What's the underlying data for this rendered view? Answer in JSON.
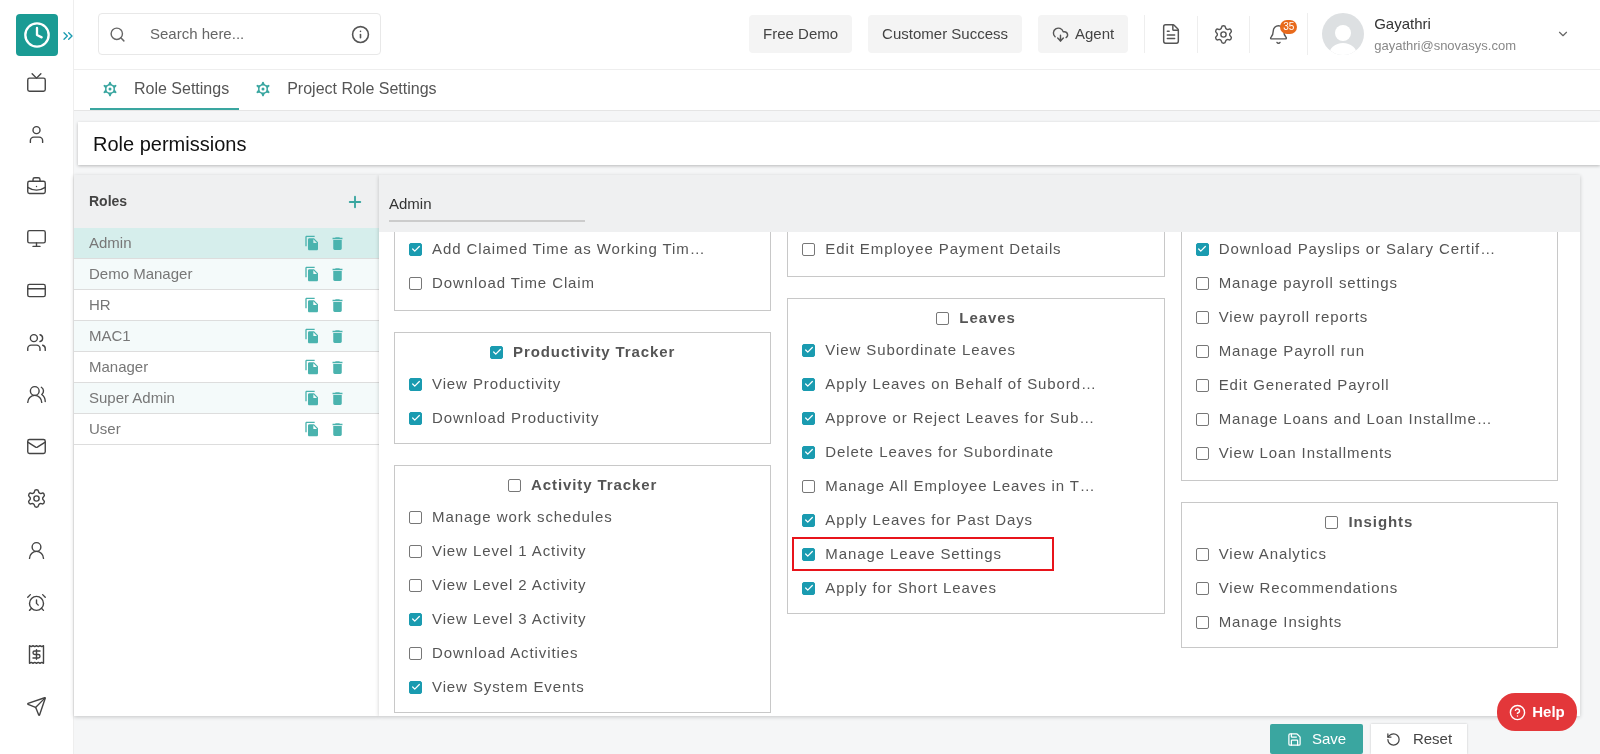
{
  "search": {
    "placeholder": "Search here..."
  },
  "header_buttons": [
    {
      "label": "Free Demo",
      "kind": "plain"
    },
    {
      "label": "Customer Success",
      "kind": "plain"
    },
    {
      "label": "Agent",
      "kind": "cloud"
    }
  ],
  "notifications": {
    "count": "35"
  },
  "user": {
    "name": "Gayathri",
    "email": "gayathri@snovasys.com"
  },
  "tabs": [
    {
      "label": "Role Settings",
      "selected": true
    },
    {
      "label": "Project Role Settings",
      "selected": false
    }
  ],
  "page_title": "Role permissions",
  "roles": {
    "title": "Roles",
    "items": [
      {
        "name": "Admin",
        "selected": true
      },
      {
        "name": "Demo Manager",
        "selected": false
      },
      {
        "name": "HR",
        "selected": false
      },
      {
        "name": "MAC1",
        "selected": false
      },
      {
        "name": "Manager",
        "selected": false
      },
      {
        "name": "Super Admin",
        "selected": false
      },
      {
        "name": "User",
        "selected": false
      }
    ]
  },
  "selected_role": {
    "value": "Admin"
  },
  "permission_columns": [
    [
      {
        "items": [
          {
            "label": "Add Claimed Time as Working Tim…",
            "checked": true
          },
          {
            "label": "Download Time Claim",
            "checked": false
          }
        ]
      },
      {
        "title": "Productivity Tracker",
        "checked": true,
        "items": [
          {
            "label": "View Productivity",
            "checked": true
          },
          {
            "label": "Download Productivity",
            "checked": true
          }
        ]
      },
      {
        "title": "Activity Tracker",
        "checked": false,
        "items": [
          {
            "label": "Manage work schedules",
            "checked": false
          },
          {
            "label": "View Level 1 Activity",
            "checked": false
          },
          {
            "label": "View Level 2 Activity",
            "checked": false
          },
          {
            "label": "View Level 3 Activity",
            "checked": true
          },
          {
            "label": "Download Activities",
            "checked": false
          },
          {
            "label": "View System Events",
            "checked": true
          }
        ]
      }
    ],
    [
      {
        "items": [
          {
            "label": "Edit Employee Payment Details",
            "checked": false
          }
        ]
      },
      {
        "title": "Leaves",
        "checked": false,
        "items": [
          {
            "label": "View Subordinate Leaves",
            "checked": true,
            "highlighted": false
          },
          {
            "label": "Apply Leaves on Behalf of Subord…",
            "checked": true,
            "highlighted": false
          },
          {
            "label": "Approve or Reject Leaves for Sub…",
            "checked": true,
            "highlighted": false
          },
          {
            "label": "Delete Leaves for Subordinate",
            "checked": true,
            "highlighted": false
          },
          {
            "label": "Manage All Employee Leaves in T…",
            "checked": false,
            "highlighted": false
          },
          {
            "label": "Apply Leaves for Past Days",
            "checked": true,
            "highlighted": false
          },
          {
            "label": "Manage Leave Settings",
            "checked": true,
            "highlighted": true
          },
          {
            "label": "Apply for Short Leaves",
            "checked": true,
            "highlighted": false
          }
        ]
      }
    ],
    [
      {
        "items": [
          {
            "label": "Download Payslips or Salary Certif…",
            "checked": true
          },
          {
            "label": "Manage payroll settings",
            "checked": false
          },
          {
            "label": "View payroll reports",
            "checked": false
          },
          {
            "label": "Manage Payroll run",
            "checked": false
          },
          {
            "label": "Edit Generated Payroll",
            "checked": false
          },
          {
            "label": "Manage Loans and Loan Installme…",
            "checked": false
          },
          {
            "label": "View Loan Installments",
            "checked": false
          }
        ]
      },
      {
        "title": "Insights",
        "checked": false,
        "items": [
          {
            "label": "View Analytics",
            "checked": false
          },
          {
            "label": "View Recommendations",
            "checked": false
          },
          {
            "label": "Manage Insights",
            "checked": false
          }
        ]
      }
    ]
  ],
  "actions": {
    "save": "Save",
    "reset": "Reset"
  },
  "help": "Help"
}
